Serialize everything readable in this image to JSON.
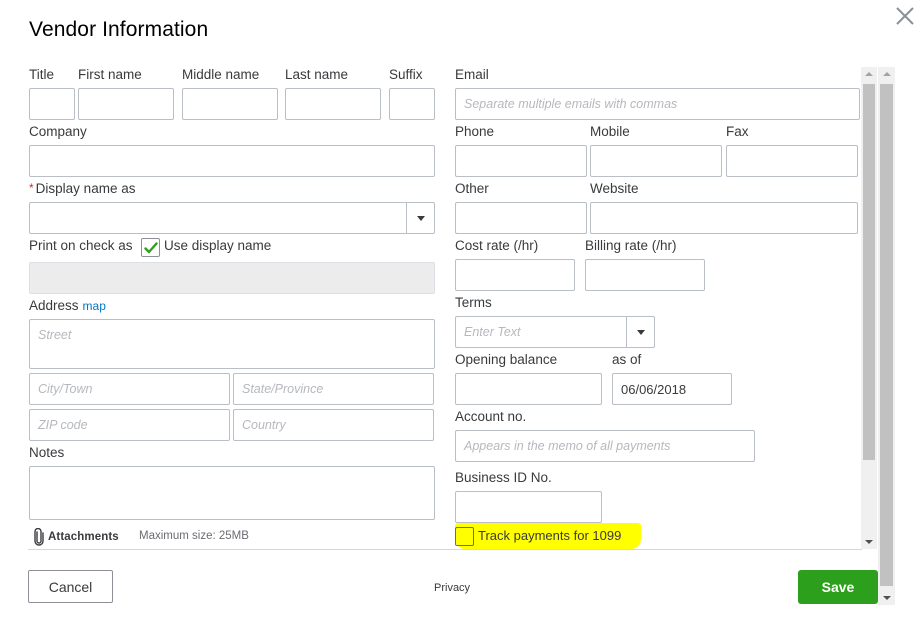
{
  "dialog": {
    "title": "Vendor Information",
    "close_icon": "close-icon"
  },
  "name_fields": {
    "title_label": "Title",
    "first_label": "First name",
    "middle_label": "Middle name",
    "last_label": "Last name",
    "suffix_label": "Suffix",
    "title_value": "",
    "first_value": "",
    "middle_value": "",
    "last_value": "",
    "suffix_value": ""
  },
  "company": {
    "label": "Company",
    "value": ""
  },
  "display_name": {
    "required_marker": "*",
    "label": "Display name as",
    "value": "",
    "icon": "chevron-down-icon"
  },
  "print_on_check": {
    "label": "Print on check as",
    "checkbox_label": "Use display name",
    "checked": true,
    "value": ""
  },
  "address": {
    "label": "Address",
    "map_link": "map",
    "street_placeholder": "Street",
    "city_placeholder": "City/Town",
    "state_placeholder": "State/Province",
    "zip_placeholder": "ZIP code",
    "country_placeholder": "Country"
  },
  "notes": {
    "label": "Notes",
    "value": ""
  },
  "attachments": {
    "icon": "paperclip-icon",
    "label": "Attachments",
    "max_size": "Maximum size: 25MB"
  },
  "email": {
    "label": "Email",
    "placeholder": "Separate multiple emails with commas"
  },
  "phone": {
    "label": "Phone",
    "value": ""
  },
  "mobile": {
    "label": "Mobile",
    "value": ""
  },
  "fax": {
    "label": "Fax",
    "value": ""
  },
  "other": {
    "label": "Other",
    "value": ""
  },
  "website": {
    "label": "Website",
    "value": ""
  },
  "cost_rate": {
    "label": "Cost rate (/hr)",
    "value": ""
  },
  "billing_rate": {
    "label": "Billing rate (/hr)",
    "value": ""
  },
  "terms": {
    "label": "Terms",
    "placeholder": "Enter Text",
    "icon": "chevron-down-icon"
  },
  "opening_balance": {
    "label": "Opening balance",
    "value": ""
  },
  "as_of": {
    "label": "as of",
    "value": "06/06/2018"
  },
  "account_no": {
    "label": "Account no.",
    "placeholder": "Appears in the memo of all payments"
  },
  "business_id": {
    "label": "Business ID No.",
    "value": ""
  },
  "track_1099": {
    "label": "Track payments for 1099",
    "checked": false,
    "highlight_color": "#ffff00"
  },
  "footer": {
    "cancel_label": "Cancel",
    "privacy_label": "Privacy",
    "save_label": "Save"
  },
  "colors": {
    "save_green": "#2ca01c",
    "link_blue": "#0077c5",
    "required_red": "#d52b1e",
    "checkmark_green": "#2ca01c"
  }
}
